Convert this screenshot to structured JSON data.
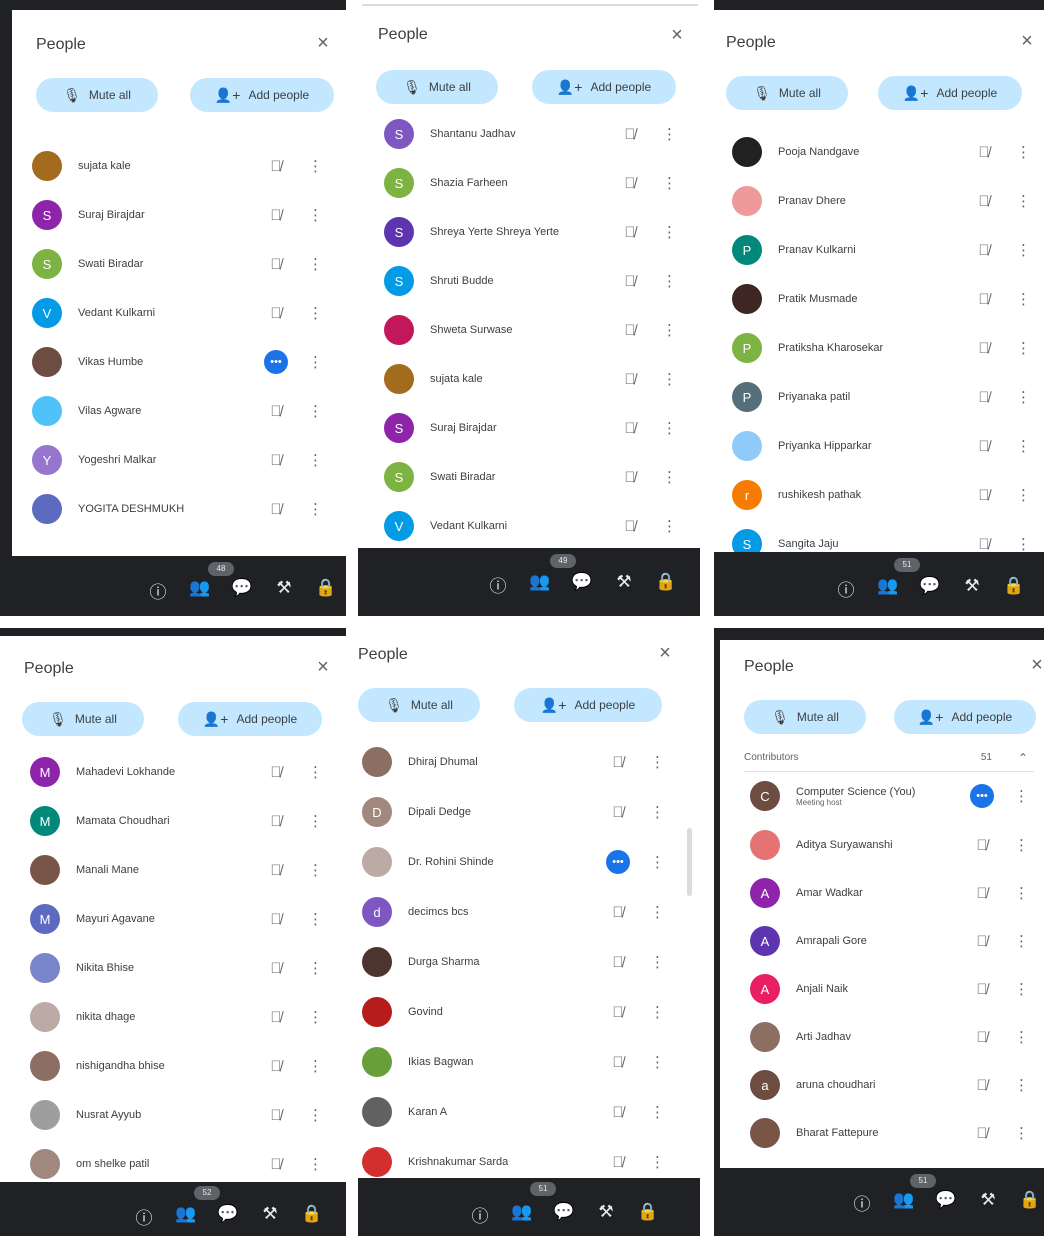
{
  "common": {
    "title": "People",
    "close": "×",
    "mute_all": "Mute all",
    "add_people": "Add people",
    "mic_off": "🎙̸",
    "more": "⋮",
    "bar_icons": [
      "ⓘ",
      "👥",
      "💬",
      "⚒",
      "🔒"
    ]
  },
  "panels": [
    {
      "badge": "48",
      "rows": [
        {
          "name": "sujata kale",
          "avatar": "",
          "color": "#a36b1e",
          "status": "mic-off"
        },
        {
          "name": "Suraj Birajdar",
          "avatar": "S",
          "color": "#8e24aa",
          "status": "mic-off"
        },
        {
          "name": "Swati Biradar",
          "avatar": "S",
          "color": "#7cb342",
          "status": "mic-off"
        },
        {
          "name": "Vedant Kulkarni",
          "avatar": "V",
          "color": "#039be5",
          "status": "mic-off"
        },
        {
          "name": "Vikas Humbe",
          "avatar": "",
          "color": "#6d4c41",
          "status": "speaking"
        },
        {
          "name": "Vilas Agware",
          "avatar": "",
          "color": "#4fc3f7",
          "status": "mic-off"
        },
        {
          "name": "Yogeshri Malkar",
          "avatar": "Y",
          "color": "#9575cd",
          "status": "mic-off"
        },
        {
          "name": "YOGITA DESHMUKH",
          "avatar": "",
          "color": "#5c6bc0",
          "status": "mic-off"
        }
      ]
    },
    {
      "badge": "49",
      "rows": [
        {
          "name": "Shantanu Jadhav",
          "avatar": "S",
          "color": "#7e57c2",
          "status": "mic-off"
        },
        {
          "name": "Shazia Farheen",
          "avatar": "S",
          "color": "#7cb342",
          "status": "mic-off"
        },
        {
          "name": "Shreya Yerte Shreya Yerte",
          "avatar": "S",
          "color": "#5e35b1",
          "status": "mic-off"
        },
        {
          "name": "Shruti Budde",
          "avatar": "S",
          "color": "#039be5",
          "status": "mic-off"
        },
        {
          "name": "Shweta Surwase",
          "avatar": "",
          "color": "#c2185b",
          "status": "mic-off"
        },
        {
          "name": "sujata kale",
          "avatar": "",
          "color": "#a36b1e",
          "status": "mic-off"
        },
        {
          "name": "Suraj Birajdar",
          "avatar": "S",
          "color": "#8e24aa",
          "status": "mic-off"
        },
        {
          "name": "Swati Biradar",
          "avatar": "S",
          "color": "#7cb342",
          "status": "mic-off"
        },
        {
          "name": "Vedant Kulkarni",
          "avatar": "V",
          "color": "#039be5",
          "status": "mic-off"
        }
      ]
    },
    {
      "badge": "51",
      "rows": [
        {
          "name": "Pooja Nandgave",
          "avatar": "",
          "color": "#212121",
          "status": "mic-off"
        },
        {
          "name": "Pranav Dhere",
          "avatar": "",
          "color": "#ef9a9a",
          "status": "mic-off"
        },
        {
          "name": "Pranav Kulkarni",
          "avatar": "P",
          "color": "#00897b",
          "status": "mic-off"
        },
        {
          "name": "Pratik Musmade",
          "avatar": "",
          "color": "#3e2723",
          "status": "mic-off"
        },
        {
          "name": "Pratiksha Kharosekar",
          "avatar": "P",
          "color": "#7cb342",
          "status": "mic-off"
        },
        {
          "name": "Priyanaka patil",
          "avatar": "P",
          "color": "#546e7a",
          "status": "mic-off"
        },
        {
          "name": "Priyanka Hipparkar",
          "avatar": "",
          "color": "#90caf9",
          "status": "mic-off"
        },
        {
          "name": "rushikesh pathak",
          "avatar": "r",
          "color": "#f57c00",
          "status": "mic-off"
        },
        {
          "name": "Sangita Jaju",
          "avatar": "S",
          "color": "#039be5",
          "status": "mic-off"
        }
      ]
    },
    {
      "badge": "52",
      "rows": [
        {
          "name": "Mahadevi Lokhande",
          "avatar": "M",
          "color": "#8e24aa",
          "status": "mic-off"
        },
        {
          "name": "Mamata Choudhari",
          "avatar": "M",
          "color": "#00897b",
          "status": "mic-off"
        },
        {
          "name": "Manali Mane",
          "avatar": "",
          "color": "#795548",
          "status": "mic-off"
        },
        {
          "name": "Mayuri Agavane",
          "avatar": "M",
          "color": "#5c6bc0",
          "status": "mic-off"
        },
        {
          "name": "Nikita Bhise",
          "avatar": "",
          "color": "#7986cb",
          "status": "mic-off"
        },
        {
          "name": "nikita dhage",
          "avatar": "",
          "color": "#bcaaa4",
          "status": "mic-off"
        },
        {
          "name": "nishigandha bhise",
          "avatar": "",
          "color": "#8d6e63",
          "status": "mic-off"
        },
        {
          "name": "Nusrat Ayyub",
          "avatar": "",
          "color": "#9e9e9e",
          "status": "mic-off"
        },
        {
          "name": "om shelke patil",
          "avatar": "",
          "color": "#a1887f",
          "status": "mic-off"
        }
      ]
    },
    {
      "badge": "51",
      "rows": [
        {
          "name": "Dhiraj Dhumal",
          "avatar": "",
          "color": "#8d6e63",
          "status": "mic-off"
        },
        {
          "name": "Dipali Dedge",
          "avatar": "D",
          "color": "#a1887f",
          "status": "mic-off"
        },
        {
          "name": "Dr. Rohini Shinde",
          "avatar": "",
          "color": "#bcaaa4",
          "status": "speaking"
        },
        {
          "name": "decimcs bcs",
          "avatar": "d",
          "color": "#7e57c2",
          "status": "mic-off"
        },
        {
          "name": "Durga Sharma",
          "avatar": "",
          "color": "#4e342e",
          "status": "mic-off"
        },
        {
          "name": "Govind",
          "avatar": "",
          "color": "#b71c1c",
          "status": "mic-off"
        },
        {
          "name": "Ikias Bagwan",
          "avatar": "",
          "color": "#689f38",
          "status": "mic-off"
        },
        {
          "name": "Karan A",
          "avatar": "",
          "color": "#616161",
          "status": "mic-off"
        },
        {
          "name": "Krishnakumar Sarda",
          "avatar": "",
          "color": "#d32f2f",
          "status": "mic-off"
        }
      ]
    },
    {
      "badge": "51",
      "section": {
        "label": "Contributors",
        "count": "51",
        "chevron": "⌃"
      },
      "rows": [
        {
          "name": "Computer Science (You)",
          "sub": "Meeting host",
          "avatar": "C",
          "color": "#6d4c41",
          "status": "speaking"
        },
        {
          "name": "Aditya Suryawanshi",
          "avatar": "",
          "color": "#e57373",
          "status": "mic-off"
        },
        {
          "name": "Amar Wadkar",
          "avatar": "A",
          "color": "#8e24aa",
          "status": "mic-off"
        },
        {
          "name": "Amrapali Gore",
          "avatar": "A",
          "color": "#5e35b1",
          "status": "mic-off"
        },
        {
          "name": "Anjali Naik",
          "avatar": "A",
          "color": "#e91e63",
          "status": "mic-off"
        },
        {
          "name": "Arti Jadhav",
          "avatar": "",
          "color": "#8d6e63",
          "status": "mic-off"
        },
        {
          "name": "aruna choudhari",
          "avatar": "a",
          "color": "#6d4c41",
          "status": "mic-off"
        },
        {
          "name": "Bharat Fattepure",
          "avatar": "",
          "color": "#795548",
          "status": "mic-off"
        }
      ]
    }
  ]
}
